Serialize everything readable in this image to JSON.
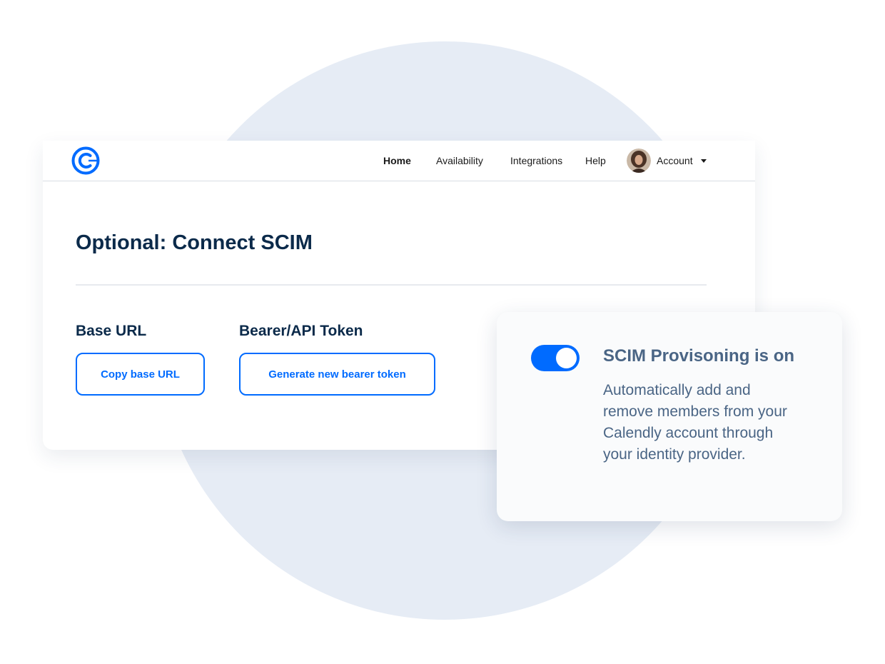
{
  "nav": {
    "home": "Home",
    "availability": "Availability",
    "integrations": "Integrations",
    "help": "Help",
    "account": "Account"
  },
  "page": {
    "title": "Optional: Connect SCIM",
    "base_url": {
      "label": "Base URL",
      "button": "Copy base URL"
    },
    "bearer": {
      "label": "Bearer/API Token",
      "button": "Generate new bearer token"
    }
  },
  "scim_card": {
    "toggle_on": true,
    "title": "SCIM Provisoning is on",
    "description": "Automatically add and remove members from your Calendly account through your identity provider."
  },
  "colors": {
    "brand_blue": "#006bff",
    "heading_navy": "#0b2a4a",
    "muted_slate": "#4a6585",
    "background_circle": "#e6ecf5"
  },
  "icons": {
    "logo": "calendly-logo-icon",
    "account_caret": "caret-down-icon"
  }
}
